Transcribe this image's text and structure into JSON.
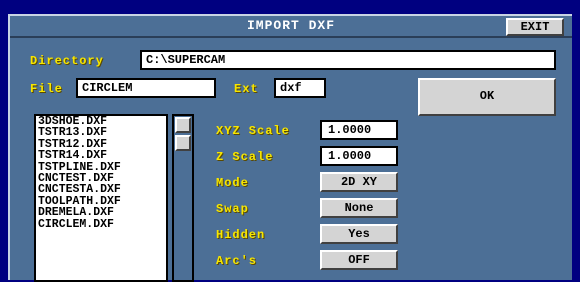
{
  "window": {
    "title": "IMPORT DXF",
    "exit_label": "EXIT"
  },
  "directory": {
    "label": "Directory",
    "value": "C:\\SUPERCAM"
  },
  "file": {
    "label": "File",
    "value": "CIRCLEM"
  },
  "ext": {
    "label": "Ext",
    "value": "dxf"
  },
  "ok_label": "OK",
  "file_list": [
    "3DSHOE.DXF",
    "TSTR13.DXF",
    "TSTR12.DXF",
    "TSTR14.DXF",
    "TSTPLINE.DXF",
    "CNCTEST.DXF",
    "CNCTESTA.DXF",
    "TOOLPATH.DXF",
    "DREMELA.DXF",
    "CIRCLEM.DXF"
  ],
  "settings": {
    "xyz_scale": {
      "label": "XYZ Scale",
      "value": "1.0000"
    },
    "z_scale": {
      "label": "Z Scale",
      "value": "1.0000"
    },
    "mode": {
      "label": "Mode",
      "value": "2D XY"
    },
    "swap": {
      "label": "Swap",
      "value": "None"
    },
    "hidden": {
      "label": "Hidden",
      "value": "Yes"
    },
    "arcs": {
      "label": "Arc's",
      "value": "OFF"
    }
  }
}
